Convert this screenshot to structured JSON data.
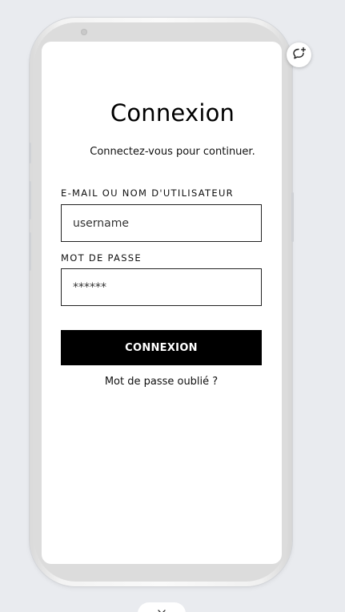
{
  "login": {
    "title": "Connexion",
    "subtitle": "Connectez-vous pour continuer.",
    "username_label": "E-MAIL OU NOM D'UTILISATEUR",
    "username_placeholder": "username",
    "password_label": "MOT DE PASSE",
    "password_value": "******",
    "submit_label": "CONNEXION",
    "forgot_label": "Mot de passe oublié ?"
  },
  "icons": {
    "float_button": "chat-add-icon",
    "bottom_tab": "chevron-down-icon"
  },
  "colors": {
    "page_background": "#e9ebef",
    "button_background": "#000000",
    "button_text": "#ffffff",
    "input_border": "#222222"
  }
}
